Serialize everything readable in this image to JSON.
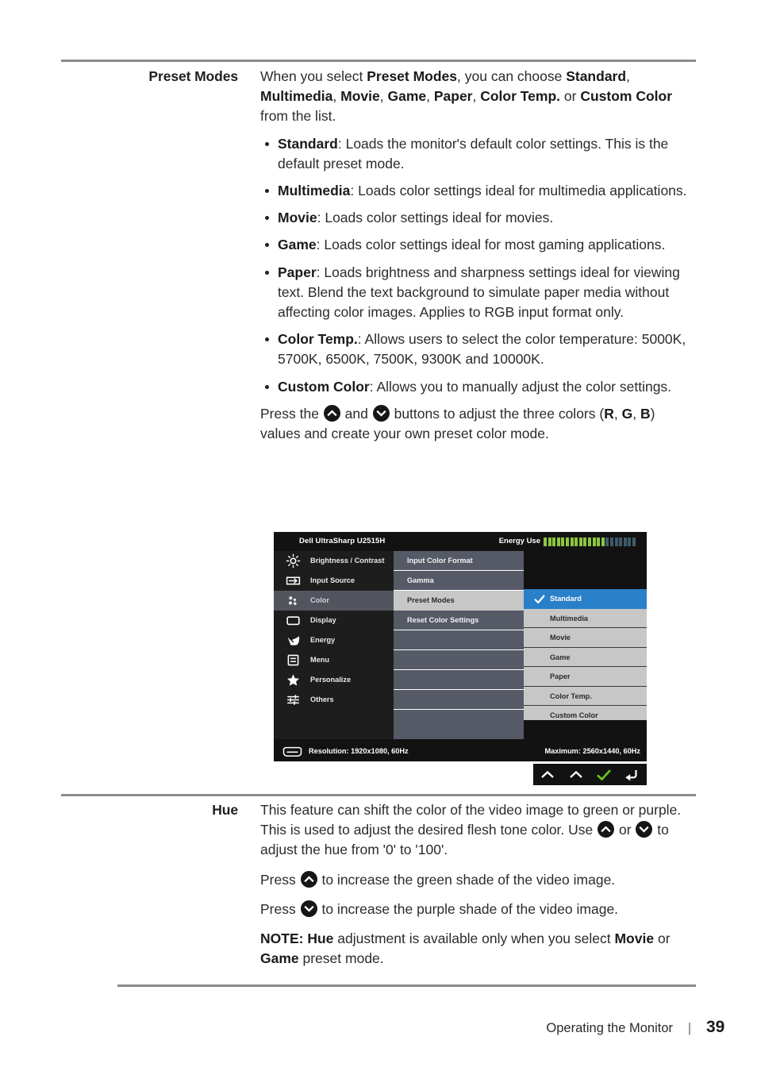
{
  "page": {
    "footer_breadcrumb": "Operating the Monitor",
    "footer_separator": "|",
    "page_number": "39"
  },
  "rows": [
    {
      "label": "Preset Modes",
      "intro_parts": [
        {
          "t": "When you select ",
          "b": false
        },
        {
          "t": "Preset Modes",
          "b": true
        },
        {
          "t": ", you can choose ",
          "b": false
        },
        {
          "t": "Standard",
          "b": true
        },
        {
          "t": ", ",
          "b": false
        },
        {
          "t": "Multimedia",
          "b": true
        },
        {
          "t": ", ",
          "b": false
        },
        {
          "t": "Movie",
          "b": true
        },
        {
          "t": ", ",
          "b": false
        },
        {
          "t": "Game",
          "b": true
        },
        {
          "t": ", ",
          "b": false
        },
        {
          "t": "Paper",
          "b": true
        },
        {
          "t": ", ",
          "b": false
        },
        {
          "t": "Color Temp.",
          "b": true
        },
        {
          "t": " or ",
          "b": false
        },
        {
          "t": "Custom Color",
          "b": true
        },
        {
          "t": " from the list.",
          "b": false
        }
      ],
      "bullets": [
        {
          "term": "Standard",
          "text": ": Loads the monitor's default color settings. This is the default preset mode."
        },
        {
          "term": "Multimedia",
          "text": ": Loads color settings ideal for multimedia applications."
        },
        {
          "term": "Movie",
          "text": ": Loads color settings ideal for movies."
        },
        {
          "term": "Game",
          "text": ": Loads color settings ideal for most gaming applications."
        },
        {
          "term": "Paper",
          "text": ": Loads brightness and sharpness settings ideal for viewing text. Blend the text background to simulate paper media without affecting color images. Applies to RGB input format only."
        },
        {
          "term": "Color Temp.",
          "text": ": Allows users to select the color temperature: 5000K, 5700K, 6500K, 7500K, 9300K and 10000K."
        },
        {
          "term": "Custom Color",
          "text": ": Allows you to manually adjust the color settings."
        }
      ],
      "closing": {
        "pre": "Press the ",
        "mid": " and ",
        "post": " buttons to adjust the three colors (",
        "r": "R",
        "comma1": ", ",
        "g": "G",
        "comma2": ", ",
        "b": "B",
        "tail": ") values and create your own preset color mode."
      }
    },
    {
      "label": "Hue",
      "paragraphs": [
        {
          "pre": "This feature can shift the color of the video image to green or purple. This is used to adjust the desired flesh tone color. Use ",
          "mid": " or ",
          "post": " to adjust the hue from '0' to '100'."
        },
        {
          "pre": "Press ",
          "post": " to increase the green shade of the video image."
        },
        {
          "pre": "Press ",
          "post": " to increase the purple shade of the video image."
        }
      ],
      "note": {
        "note_label": "NOTE:",
        "term1": "Hue",
        "text1": " adjustment is available only when you select ",
        "term2": "Movie",
        "text2": " or ",
        "term3": "Game",
        "text3": " preset mode."
      }
    }
  ],
  "osd": {
    "model_title": "Dell UltraSharp U2515H",
    "energy_label": "Energy Use",
    "energy_segments_lit": 14,
    "energy_segments_total": 21,
    "left_menu": [
      {
        "label": "Brightness / Contrast",
        "icon": "brightness-icon",
        "active": false
      },
      {
        "label": "Input Source",
        "icon": "input-source-icon",
        "active": false
      },
      {
        "label": "Color",
        "icon": "color-icon",
        "active": true
      },
      {
        "label": "Display",
        "icon": "display-icon",
        "active": false
      },
      {
        "label": "Energy",
        "icon": "energy-leaf-icon",
        "active": false
      },
      {
        "label": "Menu",
        "icon": "menu-icon",
        "active": false
      },
      {
        "label": "Personalize",
        "icon": "star-icon",
        "active": false
      },
      {
        "label": "Others",
        "icon": "sliders-icon",
        "active": false
      }
    ],
    "mid_menu": [
      {
        "label": "Input Color Format",
        "active": false
      },
      {
        "label": "Gamma",
        "active": false
      },
      {
        "label": "Preset Modes",
        "active": true
      },
      {
        "label": "Reset Color Settings",
        "active": false
      },
      {
        "label": "",
        "active": false
      },
      {
        "label": "",
        "active": false
      },
      {
        "label": "",
        "active": false
      },
      {
        "label": "",
        "active": false
      },
      {
        "label": "",
        "active": false
      }
    ],
    "preset_list": [
      {
        "label": "Standard",
        "selected": true
      },
      {
        "label": "Multimedia",
        "selected": false
      },
      {
        "label": "Movie",
        "selected": false
      },
      {
        "label": "Game",
        "selected": false
      },
      {
        "label": "Paper",
        "selected": false
      },
      {
        "label": "Color Temp.",
        "selected": false
      },
      {
        "label": "Custom Color",
        "selected": false
      }
    ],
    "status_bar": {
      "resolution": "Resolution: 1920x1080, 60Hz",
      "maximum": "Maximum: 2560x1440, 60Hz"
    },
    "buttons": [
      {
        "icon": "chevron-up-icon"
      },
      {
        "icon": "chevron-up-icon"
      },
      {
        "icon": "check-icon"
      },
      {
        "icon": "back-arrow-icon"
      }
    ],
    "colors": {
      "energy_lit": "#8dc63f",
      "energy_off": "#3f5b6b",
      "selected_blue": "#2a7fc9",
      "check_green": "#6ec81e"
    }
  }
}
